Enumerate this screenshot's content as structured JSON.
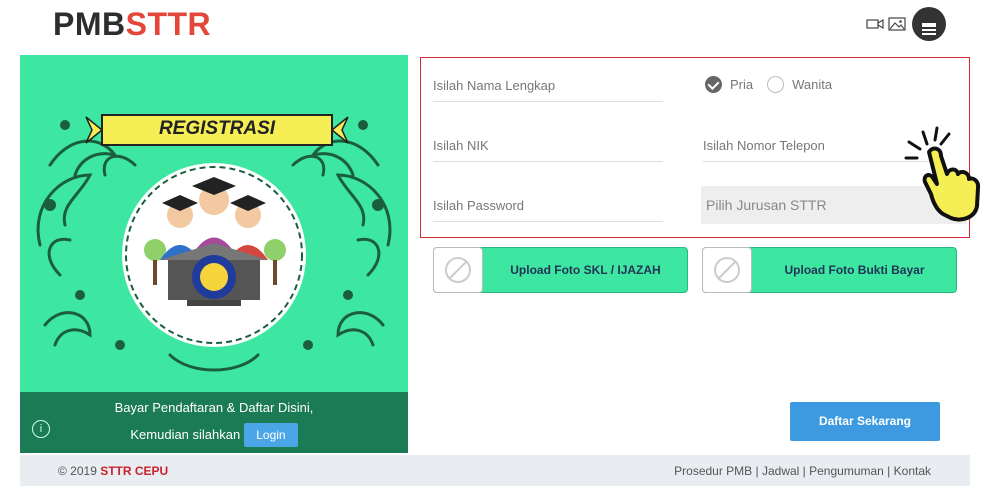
{
  "brand": {
    "part1": "PMB",
    "part2": "STTR"
  },
  "header": {
    "icons": [
      "video-icon",
      "image-icon",
      "menu-icon"
    ]
  },
  "left_panel": {
    "banner": "REGISTRASI",
    "line1": "Bayar Pendaftaran & Daftar Disini,",
    "line2": "Kemudian silahkan",
    "login": "Login"
  },
  "form": {
    "name_placeholder": "Isilah Nama Lengkap",
    "gender": {
      "options": [
        "Pria",
        "Wanita"
      ],
      "selected": "Pria"
    },
    "nik_placeholder": "Isilah NIK",
    "phone_placeholder": "Isilah Nomor Telepon",
    "password_placeholder": "Isilah Password",
    "jurusan_placeholder": "Pilih Jurusan STTR"
  },
  "uploads": {
    "skl": "Upload Foto SKL / IJAZAH",
    "bayar": "Upload Foto Bukti Bayar"
  },
  "submit": "Daftar Sekarang",
  "footer": {
    "copyright": "© 2019",
    "org": "STTR CEPU",
    "links": [
      "Prosedur PMB",
      "Jadwal",
      "Pengumuman",
      "Kontak"
    ]
  },
  "colors": {
    "accent": "#3ee7a1",
    "dark_green": "#1b7b55",
    "brand_red": "#e4473a",
    "button_blue": "#3d9ae0",
    "form_border": "#d02a36"
  }
}
